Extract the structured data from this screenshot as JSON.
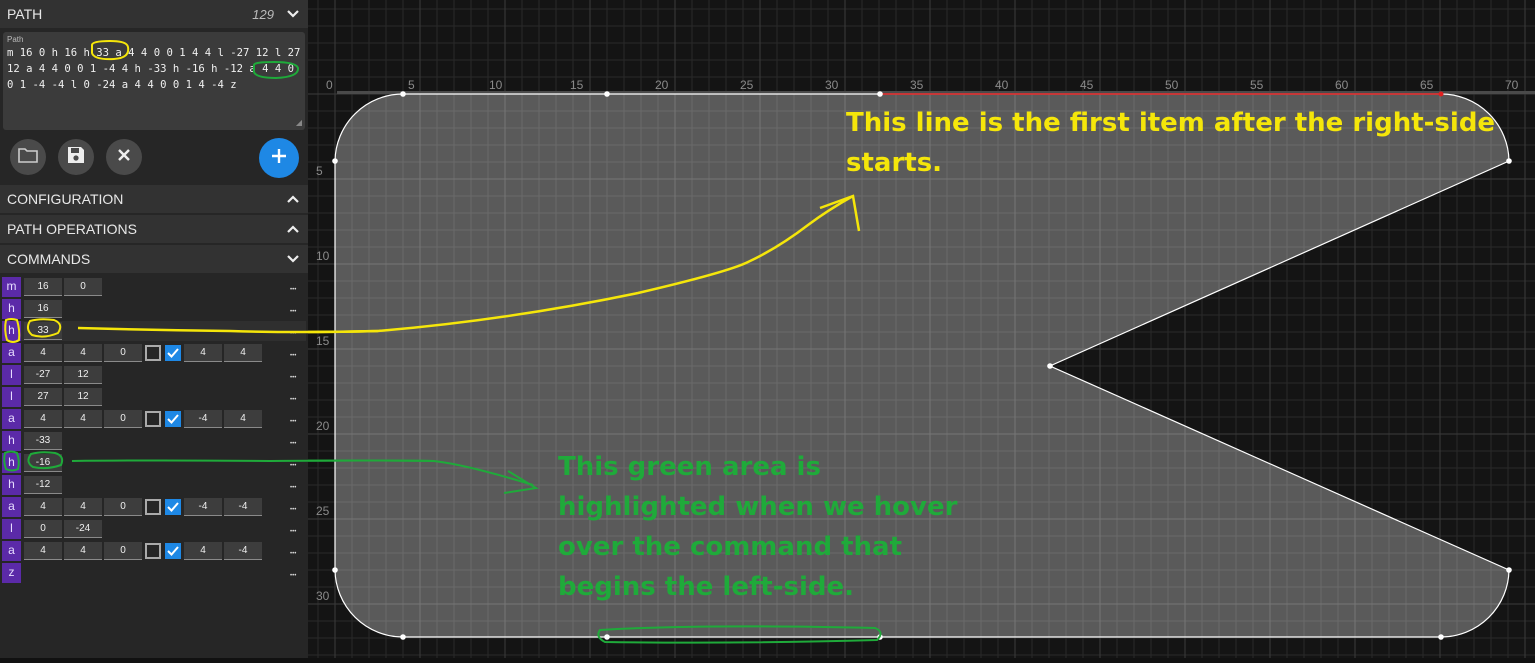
{
  "sidebar": {
    "path_section": {
      "title": "PATH",
      "count": "129"
    },
    "path_field": {
      "label": "Path",
      "value": "m 16 0 h 16 h 33 a 4 4 0 0 1 4 4 l -27 12 l 27 12 a 4 4 0 0 1 -4 4 h -33 h -16 h -12 a 4 4 0 0 1 -4 -4 l 0 -24 a 4 4 0 0 1 4 -4 z"
    },
    "buttons": {
      "open": "folder-icon",
      "save": "save-icon",
      "clear": "close-icon",
      "add": "plus-icon"
    },
    "sections": [
      {
        "title": "CONFIGURATION",
        "chevron": "up"
      },
      {
        "title": "PATH OPERATIONS",
        "chevron": "up"
      },
      {
        "title": "COMMANDS",
        "chevron": "down"
      }
    ],
    "commands": [
      {
        "cmd": "m",
        "args": [
          "16",
          "0"
        ]
      },
      {
        "cmd": "h",
        "args": [
          "16"
        ]
      },
      {
        "cmd": "h",
        "args": [
          "33"
        ],
        "highlight": "yellow"
      },
      {
        "cmd": "a",
        "args": [
          "4",
          "4",
          "0"
        ],
        "large_arc": false,
        "sweep": true,
        "end": [
          "4",
          "4"
        ]
      },
      {
        "cmd": "l",
        "args": [
          "-27",
          "12"
        ]
      },
      {
        "cmd": "l",
        "args": [
          "27",
          "12"
        ]
      },
      {
        "cmd": "a",
        "args": [
          "4",
          "4",
          "0"
        ],
        "large_arc": false,
        "sweep": true,
        "end": [
          "-4",
          "4"
        ]
      },
      {
        "cmd": "h",
        "args": [
          "-33"
        ]
      },
      {
        "cmd": "h",
        "args": [
          "-16"
        ],
        "highlight": "green"
      },
      {
        "cmd": "h",
        "args": [
          "-12"
        ]
      },
      {
        "cmd": "a",
        "args": [
          "4",
          "4",
          "0"
        ],
        "large_arc": false,
        "sweep": true,
        "end": [
          "-4",
          "-4"
        ]
      },
      {
        "cmd": "l",
        "args": [
          "0",
          "-24"
        ]
      },
      {
        "cmd": "a",
        "args": [
          "4",
          "4",
          "0"
        ],
        "large_arc": false,
        "sweep": true,
        "end": [
          "4",
          "-4"
        ]
      },
      {
        "cmd": "z",
        "args": []
      }
    ],
    "more_icon": "more-icon"
  },
  "canvas": {
    "x_ticks": [
      "0",
      "5",
      "10",
      "15",
      "20",
      "25",
      "30",
      "35",
      "40",
      "45",
      "50",
      "55",
      "60",
      "65",
      "70"
    ],
    "y_ticks": [
      "5",
      "10",
      "15",
      "20",
      "25",
      "30"
    ],
    "annotations": {
      "yellow": "This line is the first item after the right-side starts.",
      "yellow_lines": [
        "This line is the first item after the right-side",
        "starts."
      ],
      "green_lines": [
        "This green area is",
        "highlighted when we hover",
        "over the command that",
        "begins the left-side."
      ]
    },
    "colors": {
      "yellow": "#f5e60a",
      "green": "#1faa3a",
      "accent": "#1e88e5",
      "command": "#5b2aa8",
      "active_segment": "#e02020"
    }
  }
}
